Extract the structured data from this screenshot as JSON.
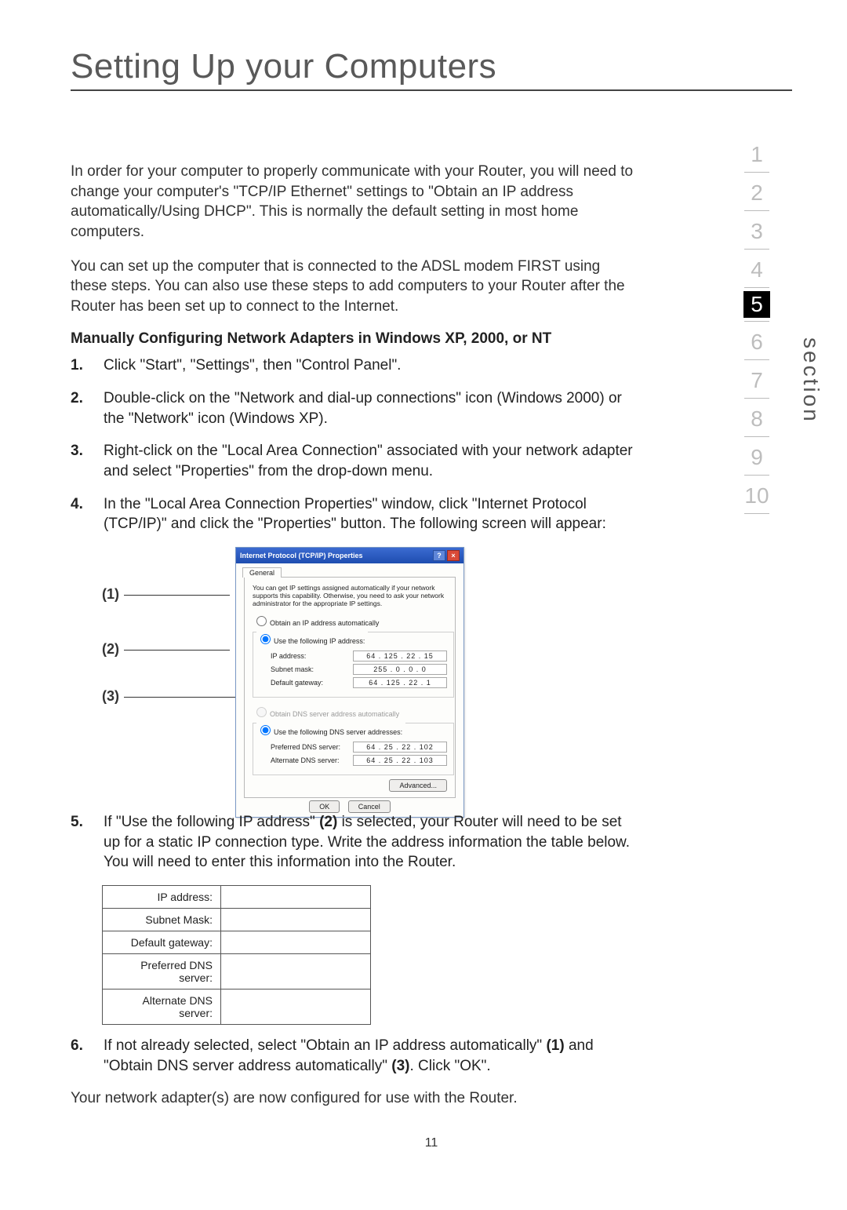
{
  "title": "Setting Up your Computers",
  "section_label": "section",
  "nav": {
    "items": [
      "1",
      "2",
      "3",
      "4",
      "5",
      "6",
      "7",
      "8",
      "9",
      "10"
    ],
    "active_index": 4
  },
  "intro1": "In order for your computer to properly communicate with your Router, you will need to change your computer's \"TCP/IP Ethernet\" settings to \"Obtain an IP address automatically/Using DHCP\". This is normally the default setting in most home computers.",
  "intro2": "You can set up the computer that is connected to the ADSL modem FIRST using these steps. You can also use these steps to add computers to your Router after the Router has been set up to connect to the Internet.",
  "subhead": "Manually Configuring Network Adapters in Windows XP, 2000, or NT",
  "steps": {
    "s1": "Click \"Start\", \"Settings\", then \"Control Panel\".",
    "s2": "Double-click on the \"Network and dial-up connections\" icon (Windows 2000) or the \"Network\" icon (Windows XP).",
    "s3": "Right-click on the \"Local Area Connection\" associated with your network adapter and select \"Properties\" from the drop-down menu.",
    "s4": "In the \"Local Area Connection Properties\" window, click \"Internet Protocol (TCP/IP)\" and click the \"Properties\" button. The following screen will appear:",
    "s5a": "If \"Use the following IP address\" ",
    "s5b": " is selected, your Router will need to be set up for a static IP connection type. Write the address information the table below. You will need to enter this information into the Router.",
    "s5bold": "(2)",
    "s6a": "If not already selected, select \"Obtain an IP address automatically\" ",
    "s6b": " and \"Obtain DNS server address automatically\" ",
    "s6c": ". Click \"OK\".",
    "s6bold1": "(1)",
    "s6bold2": "(3)"
  },
  "callouts": {
    "c1": "(1)",
    "c2": "(2)",
    "c3": "(3)"
  },
  "dialog": {
    "title": "Internet Protocol (TCP/IP) Properties",
    "help_icon": "?",
    "close_icon": "×",
    "tab": "General",
    "blurb": "You can get IP settings assigned automatically if your network supports this capability. Otherwise, you need to ask your network administrator for the appropriate IP settings.",
    "r_auto_ip": "Obtain an IP address automatically",
    "r_use_ip": "Use the following IP address:",
    "lbl_ip": "IP address:",
    "lbl_mask": "Subnet mask:",
    "lbl_gw": "Default gateway:",
    "val_ip": "64 . 125 . 22 . 15",
    "val_mask": "255 . 0 . 0 . 0",
    "val_gw": "64 . 125 . 22 . 1",
    "r_auto_dns": "Obtain DNS server address automatically",
    "r_use_dns": "Use the following DNS server addresses:",
    "lbl_pdns": "Preferred DNS server:",
    "lbl_adns": "Alternate DNS server:",
    "val_pdns": "64 . 25 . 22 . 102",
    "val_adns": "64 . 25 . 22 . 103",
    "btn_adv": "Advanced...",
    "btn_ok": "OK",
    "btn_cancel": "Cancel"
  },
  "worksheet": {
    "ip": "IP address:",
    "mask": "Subnet Mask:",
    "gw": "Default gateway:",
    "pdns": "Preferred DNS server:",
    "adns": "Alternate DNS server:"
  },
  "closing": "Your network adapter(s) are now configured for use with the Router.",
  "pagenum": "11"
}
